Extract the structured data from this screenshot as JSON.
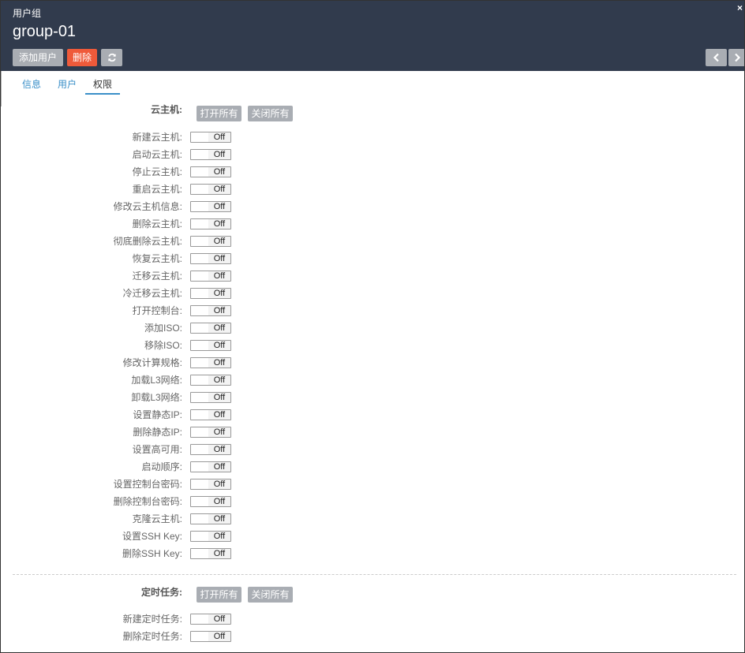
{
  "header": {
    "kicker": "用户组",
    "title": "group-01",
    "close_label": "×",
    "add_user_label": "添加用户",
    "delete_label": "删除",
    "refresh_icon": "refresh-icon",
    "prev_icon": "chevron-left-icon",
    "next_icon": "chevron-right-icon"
  },
  "tabs": [
    {
      "label": "信息",
      "active": false
    },
    {
      "label": "用户",
      "active": false
    },
    {
      "label": "权限",
      "active": true
    }
  ],
  "sections": [
    {
      "title": "云主机:",
      "open_all_label": "打开所有",
      "close_all_label": "关闭所有",
      "items": [
        {
          "label": "新建云主机:",
          "state": "Off"
        },
        {
          "label": "启动云主机:",
          "state": "Off"
        },
        {
          "label": "停止云主机:",
          "state": "Off"
        },
        {
          "label": "重启云主机:",
          "state": "Off"
        },
        {
          "label": "修改云主机信息:",
          "state": "Off"
        },
        {
          "label": "删除云主机:",
          "state": "Off"
        },
        {
          "label": "彻底删除云主机:",
          "state": "Off"
        },
        {
          "label": "恢复云主机:",
          "state": "Off"
        },
        {
          "label": "迁移云主机:",
          "state": "Off"
        },
        {
          "label": "冷迁移云主机:",
          "state": "Off"
        },
        {
          "label": "打开控制台:",
          "state": "Off"
        },
        {
          "label": "添加ISO:",
          "state": "Off"
        },
        {
          "label": "移除ISO:",
          "state": "Off"
        },
        {
          "label": "修改计算规格:",
          "state": "Off"
        },
        {
          "label": "加载L3网络:",
          "state": "Off"
        },
        {
          "label": "卸载L3网络:",
          "state": "Off"
        },
        {
          "label": "设置静态IP:",
          "state": "Off"
        },
        {
          "label": "删除静态IP:",
          "state": "Off"
        },
        {
          "label": "设置高可用:",
          "state": "Off"
        },
        {
          "label": "启动顺序:",
          "state": "Off"
        },
        {
          "label": "设置控制台密码:",
          "state": "Off"
        },
        {
          "label": "删除控制台密码:",
          "state": "Off"
        },
        {
          "label": "克隆云主机:",
          "state": "Off"
        },
        {
          "label": "设置SSH Key:",
          "state": "Off"
        },
        {
          "label": "删除SSH Key:",
          "state": "Off"
        }
      ]
    },
    {
      "title": "定时任务:",
      "open_all_label": "打开所有",
      "close_all_label": "关闭所有",
      "items": [
        {
          "label": "新建定时任务:",
          "state": "Off"
        },
        {
          "label": "删除定时任务:",
          "state": "Off"
        }
      ]
    }
  ]
}
